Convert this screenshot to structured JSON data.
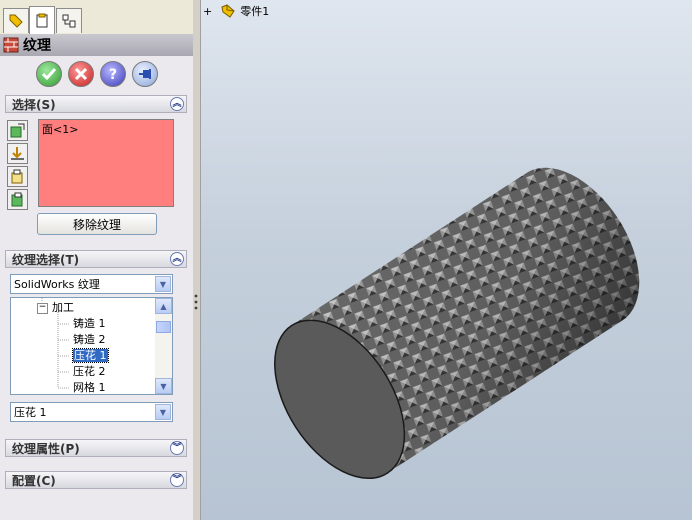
{
  "panel": {
    "title": "纹理",
    "selection": {
      "heading": "选择(S)",
      "items": [
        "面<1>"
      ],
      "remove_button": "移除纹理"
    },
    "texture_select": {
      "heading": "纹理选择(T)",
      "library": "SolidWorks 纹理",
      "tree": [
        {
          "label": "加工",
          "level": 0,
          "expanded": true,
          "selected": false
        },
        {
          "label": "铸造 1",
          "level": 1,
          "selected": false
        },
        {
          "label": "铸造 2",
          "level": 1,
          "selected": false
        },
        {
          "label": "压花 1",
          "level": 1,
          "selected": true
        },
        {
          "label": "压花 2",
          "level": 1,
          "selected": false
        },
        {
          "label": "网格 1",
          "level": 1,
          "selected": false
        }
      ],
      "current": "压花 1"
    },
    "properties": {
      "heading": "纹理属性(P)"
    },
    "config": {
      "heading": "配置(C)"
    }
  },
  "feature_tree": {
    "root_label": "零件1",
    "expand_symbol": "+"
  },
  "colors": {
    "selection_fill": "#ff7f7f",
    "accent": "#316ac5"
  }
}
